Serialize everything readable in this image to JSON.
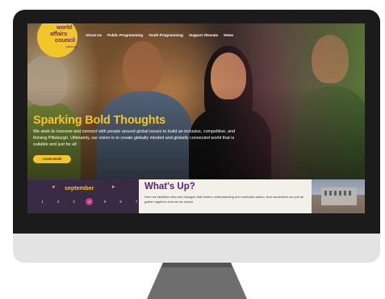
{
  "logo": {
    "line1": "world",
    "line2": "affairs",
    "line3": "council",
    "line4": "pittsburgh"
  },
  "nav": {
    "items": [
      "About Us",
      "Public Programming",
      "Youth Programming",
      "Support #Donate",
      "News"
    ]
  },
  "hero": {
    "title": "Sparking Bold Thoughts",
    "text": "We seek to convene and connect with people around global issues to build an inclusive, competitive, and thriving Pittsburgh. Ultimately, our vision is to create globally minded and globally connected world that is suitable and just for all",
    "button": "LEARN MORE"
  },
  "calendar": {
    "month": "september",
    "prev": "◂",
    "next": "▸",
    "days": [
      "1",
      "2",
      "3",
      "4",
      "5",
      "6",
      "7"
    ],
    "selected_day": "4"
  },
  "whats_up": {
    "title": "What's Up?",
    "text": "Here we facilitate informed dialogue that fosters understanding and motivates action. And sometimes we just all gather together and eat ice cream."
  },
  "colors": {
    "brand_yellow": "#f5c32b",
    "brand_purple": "#5a2274",
    "calendar_bg": "#3a2b45",
    "selected_day": "#c23e8f"
  }
}
